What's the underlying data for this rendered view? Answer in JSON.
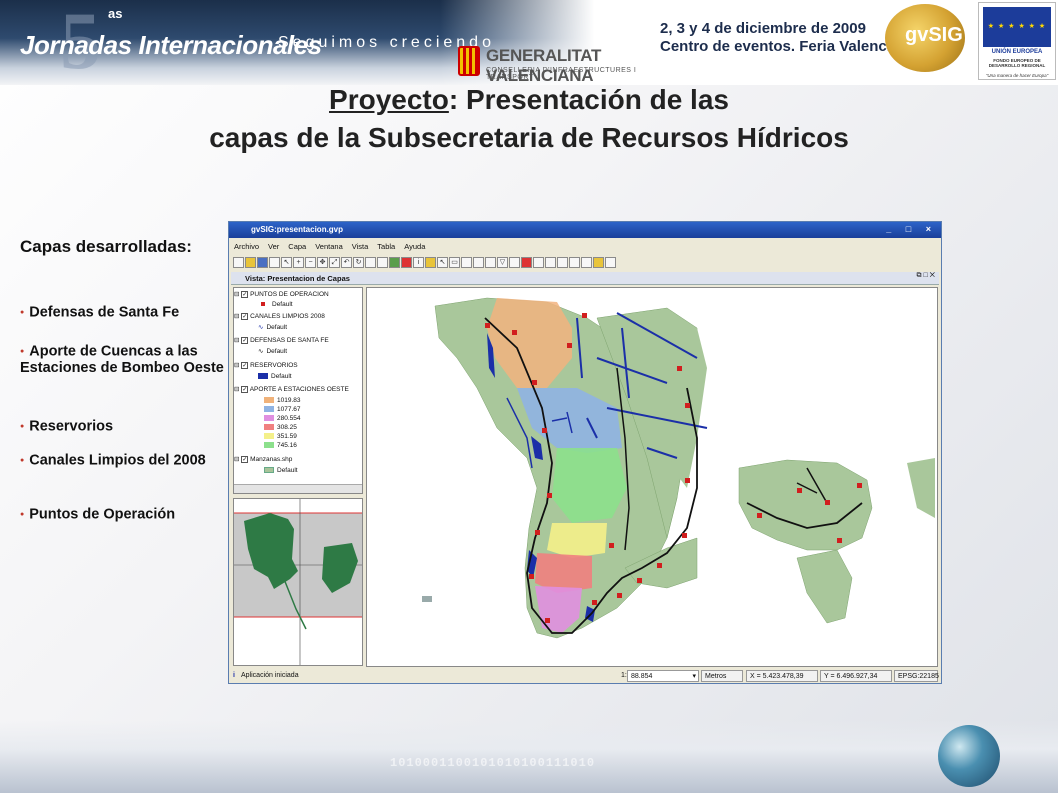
{
  "banner": {
    "event_number": "5",
    "event_number_suffix": "as",
    "event_name": "Jornadas Internacionales",
    "event_slogan": "Seguimos creciendo",
    "sponsor_name": "GENERALITAT VALENCIANA",
    "sponsor_sub": "CONSELLERIA D'INFRAESTRUCTURES I TRANSPORT",
    "date_line1": "2, 3 y 4 de diciembre de 2009",
    "date_line2": "Centro de eventos. Feria Valencia",
    "gvsig_logo": "gvSIG",
    "eu_title": "UNIÓN EUROPEA",
    "eu_fund": "FONDO EUROPEO DE DESARROLLO REGIONAL",
    "eu_motto": "\"Una manera de hacer Europa\"",
    "binary_strip": "1010001100101010100111010"
  },
  "title": {
    "prefix": "Proyecto",
    "line1_rest": ": Presentación de las",
    "line2": "capas de la Subsecretaria de Recursos Hídricos"
  },
  "sidebar": {
    "heading": "Capas desarrolladas:",
    "items": [
      {
        "label": "Defensas de Santa Fe"
      },
      {
        "label": "Aporte de Cuencas a las Estaciones de Bombeo Oeste"
      },
      {
        "label": "Reservorios"
      },
      {
        "label": "Canales Limpios del 2008"
      },
      {
        "label": "Puntos de Operación"
      }
    ]
  },
  "app": {
    "window_title": "gvSIG:presentacion.gvp",
    "window_controls": "_ □ ×",
    "menu": [
      "Archivo",
      "Ver",
      "Capa",
      "Ventana",
      "Vista",
      "Tabla",
      "Ayuda"
    ],
    "view_title": "Vista: Presentacion de Capas",
    "toc": [
      {
        "name": "PUNTOS DE OPERACION",
        "legend": "Default",
        "color": "#d11e1e"
      },
      {
        "name": "CANALES LIMPIOS 2008",
        "legend": "Default",
        "color": "#1b2fa8"
      },
      {
        "name": "DEFENSAS DE SANTA FE",
        "legend": "Default",
        "color": "#111111"
      },
      {
        "name": "RESERVORIOS",
        "legend": "Default",
        "color": "#1b2fa8"
      },
      {
        "name": "APORTE A ESTACIONES OESTE",
        "legend": "",
        "color": "#888888"
      },
      {
        "name": "Manzanas.shp",
        "legend": "Default",
        "color": "#a8c49a"
      }
    ],
    "aporte_classes": [
      {
        "value": "1019.83",
        "color": "#f0b27a"
      },
      {
        "value": "1077.67",
        "color": "#8fb3e3"
      },
      {
        "value": "280.554",
        "color": "#e08fe0"
      },
      {
        "value": "308.25",
        "color": "#f08080"
      },
      {
        "value": "351.59",
        "color": "#f4f08a"
      },
      {
        "value": "745.16",
        "color": "#8ce08c"
      }
    ],
    "status": {
      "message": "Aplicación iniciada",
      "scale_prefix": "1:",
      "scale": "88.854",
      "units": "Metros",
      "x": "X = 5.423.478,39",
      "y": "Y = 6.496.927,34",
      "epsg": "EPSG:22185"
    }
  }
}
